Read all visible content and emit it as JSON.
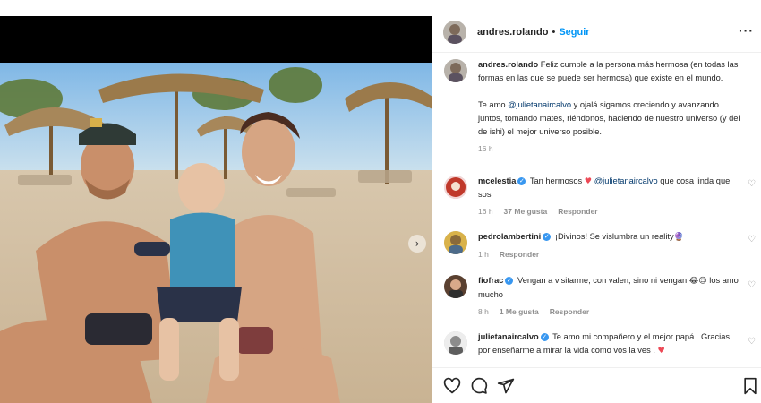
{
  "post": {
    "author": "andres.rolando",
    "follow_label": "Seguir",
    "separator": "•",
    "more_label": "···"
  },
  "caption": {
    "username": "andres.rolando",
    "text_1": "Feliz cumple a la persona más hermosa (en todas las formas en las que se puede ser hermosa) que existe en el mundo.",
    "text_2a": "Te amo ",
    "mention": "@julietanaircalvo",
    "text_2b": " y ojalá sigamos creciendo y avanzando juntos, tomando mates, riéndonos, haciendo de nuestro universo (y del de ishi) el mejor universo posible.",
    "time": "16 h"
  },
  "comments": [
    {
      "username": "mcelestia",
      "verified": true,
      "text_a": "Tan hermosos ",
      "emoji": "♥",
      "mention": "@julietanaircalvo",
      "text_b": " que cosa linda que sos",
      "time": "16 h",
      "likes": "37 Me gusta",
      "reply": "Responder"
    },
    {
      "username": "pedrolambertini",
      "verified": true,
      "text_a": "¡Divinos! Se vislumbra un reality",
      "emoji": "🔮",
      "time": "1 h",
      "reply": "Responder"
    },
    {
      "username": "fiofrac",
      "verified": true,
      "text_a": "Vengan a visitarme, con valen, sino ni vengan ",
      "emoji": "😂😍",
      "text_b": " los amo mucho",
      "time": "8 h",
      "likes": "1 Me gusta",
      "reply": "Responder"
    },
    {
      "username": "julietanaircalvo",
      "verified": true,
      "text_a": "Te amo mi compañero y el mejor papá . Gracias por enseñarme a mirar la vida como vos la ves . ",
      "emoji": "♥"
    }
  ],
  "icons": {
    "like": "heart-icon",
    "comment": "comment-icon",
    "share": "share-icon",
    "save": "bookmark-icon",
    "next": "chevron-right-icon"
  },
  "colors": {
    "link_blue": "#0095f6",
    "verified_blue": "#3897f0",
    "heart_red": "#ed4956"
  }
}
